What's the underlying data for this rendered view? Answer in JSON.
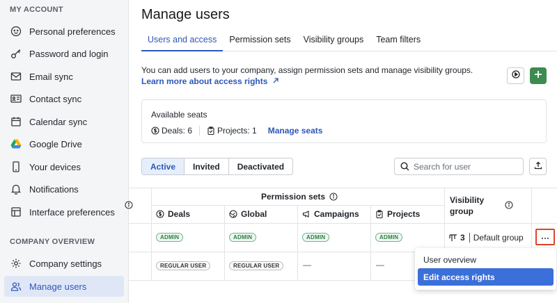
{
  "sidebar": {
    "my_account_title": "MY ACCOUNT",
    "company_title": "COMPANY OVERVIEW",
    "items": [
      {
        "label": "Personal preferences",
        "icon": "smile-icon"
      },
      {
        "label": "Password and login",
        "icon": "key-icon"
      },
      {
        "label": "Email sync",
        "icon": "mail-icon"
      },
      {
        "label": "Contact sync",
        "icon": "contact-card-icon"
      },
      {
        "label": "Calendar sync",
        "icon": "calendar-icon"
      },
      {
        "label": "Google Drive",
        "icon": "google-drive-icon"
      },
      {
        "label": "Your devices",
        "icon": "phone-icon"
      },
      {
        "label": "Notifications",
        "icon": "bell-icon"
      },
      {
        "label": "Interface preferences",
        "icon": "sliders-icon"
      }
    ],
    "company_items": [
      {
        "label": "Company settings",
        "icon": "gear-icon"
      },
      {
        "label": "Manage users",
        "icon": "users-icon",
        "active": true
      }
    ]
  },
  "main": {
    "title": "Manage users",
    "tabs": [
      "Users and access",
      "Permission sets",
      "Visibility groups",
      "Team filters"
    ],
    "intro": "You can add users to your company, assign permission sets and manage visibility groups.",
    "learn_link": "Learn more about access rights",
    "seats": {
      "title": "Available seats",
      "deals": "Deals: 6",
      "projects": "Projects: 1",
      "manage": "Manage seats"
    },
    "filters": [
      "Active",
      "Invited",
      "Deactivated"
    ],
    "search_placeholder": "Search for user"
  },
  "table": {
    "group_header": "Permission sets",
    "visibility_header": "Visibility group",
    "columns": [
      "Deals",
      "Global",
      "Campaigns",
      "Projects"
    ],
    "rows": [
      {
        "deals": "ADMIN",
        "global": "ADMIN",
        "campaigns": "ADMIN",
        "projects": "ADMIN",
        "visibility_count": "3",
        "visibility_group": "Default group"
      },
      {
        "deals": "REGULAR USER",
        "global": "REGULAR USER",
        "campaigns": "—",
        "projects": "—"
      }
    ]
  },
  "context_menu": {
    "items": [
      "User overview",
      "Edit access rights"
    ]
  },
  "colors": {
    "accent": "#2d57b8",
    "add_button": "#3c8c4f",
    "highlight_border": "#e0432f",
    "menu_highlight": "#3b6fd9"
  }
}
